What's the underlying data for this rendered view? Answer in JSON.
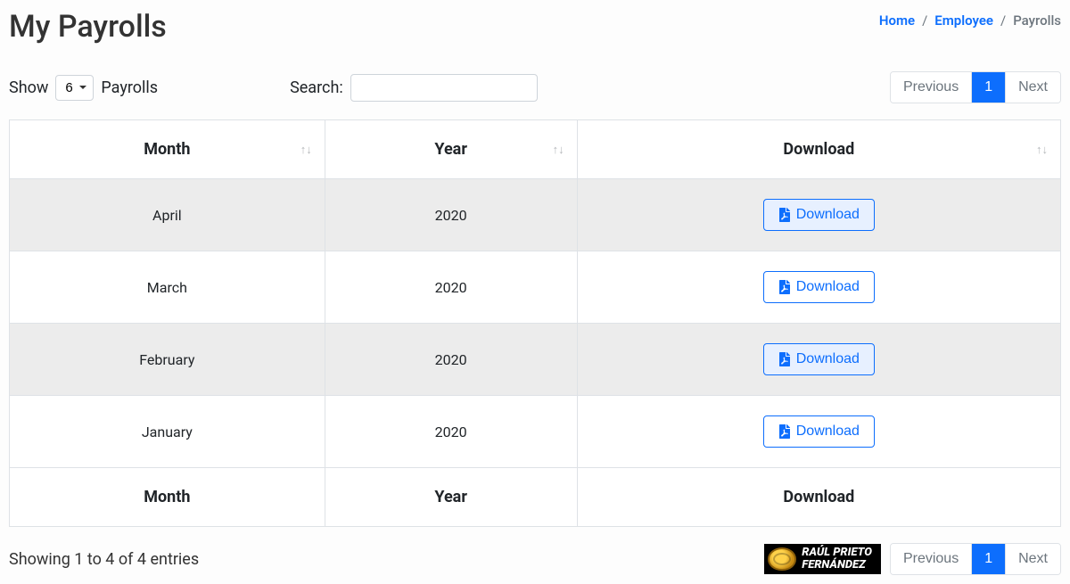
{
  "page": {
    "title": "My Payrolls"
  },
  "breadcrumb": {
    "home": "Home",
    "employee": "Employee",
    "current": "Payrolls"
  },
  "controls": {
    "show_label_prefix": "Show",
    "show_label_suffix": "Payrolls",
    "show_value": "6",
    "search_label": "Search:"
  },
  "pagination": {
    "prev": "Previous",
    "current": "1",
    "next": "Next"
  },
  "table": {
    "headers": {
      "month": "Month",
      "year": "Year",
      "download": "Download"
    },
    "footers": {
      "month": "Month",
      "year": "Year",
      "download": "Download"
    },
    "download_label": "Download",
    "rows": [
      {
        "month": "April",
        "year": "2020"
      },
      {
        "month": "March",
        "year": "2020"
      },
      {
        "month": "February",
        "year": "2020"
      },
      {
        "month": "January",
        "year": "2020"
      }
    ]
  },
  "entries_info": "Showing 1 to 4 of 4 entries",
  "brand": {
    "line1": "RAÚL PRIETO",
    "line2": "FERNÁNDEZ"
  }
}
